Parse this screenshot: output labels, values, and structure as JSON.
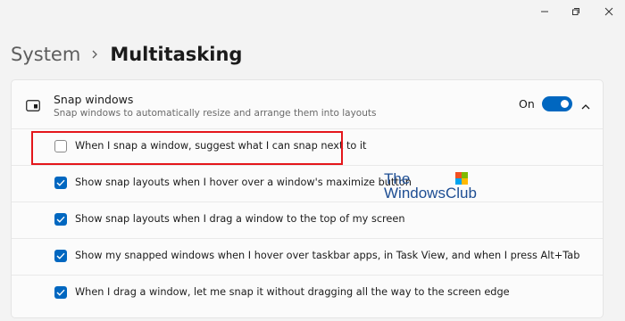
{
  "page": {
    "breadcrumb_parent": "System",
    "breadcrumb_current": "Multitasking"
  },
  "snap": {
    "title": "Snap windows",
    "subtitle": "Snap windows to automatically resize and arrange them into layouts",
    "toggle_label": "On",
    "toggle_on": true,
    "options": [
      {
        "label": "When I snap a window, suggest what I can snap next to it",
        "checked": false
      },
      {
        "label": "Show snap layouts when I hover over a window's maximize button",
        "checked": true
      },
      {
        "label": "Show snap layouts when I drag a window to the top of my screen",
        "checked": true
      },
      {
        "label": "Show my snapped windows when I hover over taskbar apps, in Task View, and when I press Alt+Tab",
        "checked": true
      },
      {
        "label": "When I drag a window, let me snap it without dragging all the way to the screen edge",
        "checked": true
      }
    ]
  },
  "watermark": {
    "line1": "The",
    "line2": "WindowsClub"
  },
  "colors": {
    "accent": "#0067c0",
    "highlight": "#e4161b",
    "watermark": "#1e4e93"
  }
}
